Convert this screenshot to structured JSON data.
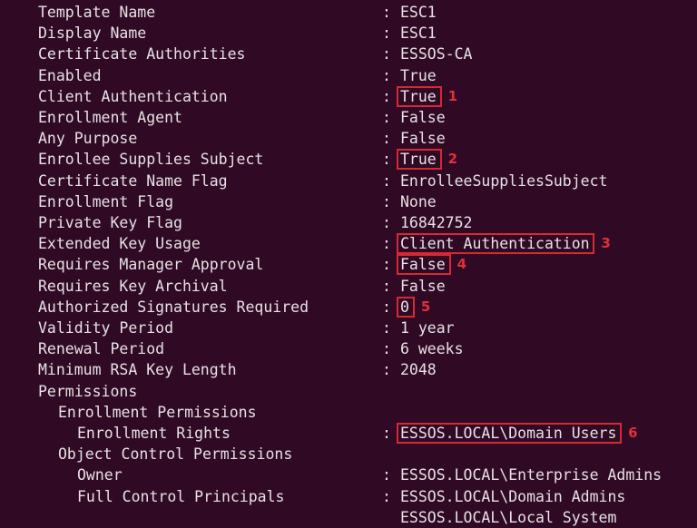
{
  "terminal": {
    "theme": {
      "background": "#300a24",
      "foreground": "#e6e1e4",
      "highlight": "#d42a33"
    },
    "rows": [
      {
        "key": "Template Name",
        "indent": 0,
        "sep": ":",
        "value": "ESC1"
      },
      {
        "key": "Display Name",
        "indent": 0,
        "sep": ":",
        "value": "ESC1"
      },
      {
        "key": "Certificate Authorities",
        "indent": 0,
        "sep": ":",
        "value": "ESSOS-CA"
      },
      {
        "key": "Enabled",
        "indent": 0,
        "sep": ":",
        "value": "True"
      },
      {
        "key": "Client Authentication",
        "indent": 0,
        "sep": ":",
        "value": "True",
        "marker": "1"
      },
      {
        "key": "Enrollment Agent",
        "indent": 0,
        "sep": ":",
        "value": "False"
      },
      {
        "key": "Any Purpose",
        "indent": 0,
        "sep": ":",
        "value": "False"
      },
      {
        "key": "Enrollee Supplies Subject",
        "indent": 0,
        "sep": ":",
        "value": "True",
        "marker": "2"
      },
      {
        "key": "Certificate Name Flag",
        "indent": 0,
        "sep": ":",
        "value": "EnrolleeSuppliesSubject"
      },
      {
        "key": "Enrollment Flag",
        "indent": 0,
        "sep": ":",
        "value": "None"
      },
      {
        "key": "Private Key Flag",
        "indent": 0,
        "sep": ":",
        "value": "16842752"
      },
      {
        "key": "Extended Key Usage",
        "indent": 0,
        "sep": ":",
        "value": "Client Authentication",
        "marker": "3"
      },
      {
        "key": "Requires Manager Approval",
        "indent": 0,
        "sep": ":",
        "value": "False",
        "marker": "4"
      },
      {
        "key": "Requires Key Archival",
        "indent": 0,
        "sep": ":",
        "value": "False"
      },
      {
        "key": "Authorized Signatures Required",
        "indent": 0,
        "sep": ":",
        "value": "0",
        "marker": "5"
      },
      {
        "key": "Validity Period",
        "indent": 0,
        "sep": ":",
        "value": "1 year"
      },
      {
        "key": "Renewal Period",
        "indent": 0,
        "sep": ":",
        "value": "6 weeks"
      },
      {
        "key": "Minimum RSA Key Length",
        "indent": 0,
        "sep": ":",
        "value": "2048"
      },
      {
        "key": "Permissions",
        "indent": 0,
        "sep": "",
        "value": ""
      },
      {
        "key": "Enrollment Permissions",
        "indent": 1,
        "sep": "",
        "value": ""
      },
      {
        "key": "Enrollment Rights",
        "indent": 2,
        "sep": ":",
        "value": "ESSOS.LOCAL\\Domain Users",
        "marker": "6"
      },
      {
        "key": "Object Control Permissions",
        "indent": 1,
        "sep": "",
        "value": ""
      },
      {
        "key": "Owner",
        "indent": 2,
        "sep": ":",
        "value": "ESSOS.LOCAL\\Enterprise Admins"
      },
      {
        "key": "Full Control Principals",
        "indent": 2,
        "sep": ":",
        "value": "ESSOS.LOCAL\\Domain Admins"
      },
      {
        "key": "",
        "indent": 2,
        "sep": "",
        "value": "ESSOS.LOCAL\\Local System"
      }
    ]
  }
}
